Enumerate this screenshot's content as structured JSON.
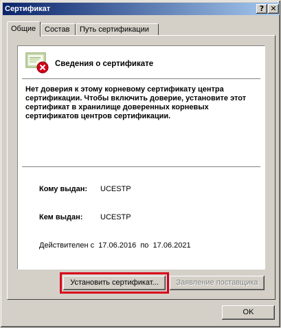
{
  "window": {
    "title": "Сертификат",
    "help_glyph": "?",
    "close_glyph": "✕"
  },
  "tabs": [
    {
      "label": "Общие",
      "active": true
    },
    {
      "label": "Состав",
      "active": false
    },
    {
      "label": "Путь сертификации",
      "active": false
    }
  ],
  "info": {
    "title": "Сведения о сертификате",
    "icon": "certificate-error-icon",
    "warning": "Нет доверия к этому корневому сертификату центра сертификации. Чтобы включить доверие, установите этот сертификат в хранилище доверенных корневых сертификатов центров сертификации.",
    "issued_to_label": "Кому выдан:",
    "issued_to_value": "UCESTP",
    "issued_by_label": "Кем выдан:",
    "issued_by_value": "UCESTP",
    "validity": "Действителен с  17.06.2016  по  17.06.2021"
  },
  "buttons": {
    "install": "Установить сертификат...",
    "issuer_statement": "Заявление поставщика",
    "ok": "OK"
  },
  "colors": {
    "titlebar_start": "#0a246a",
    "titlebar_end": "#a6caf0",
    "face": "#d4d0c8",
    "highlight": "#d9001a",
    "error": "#d4001a"
  }
}
